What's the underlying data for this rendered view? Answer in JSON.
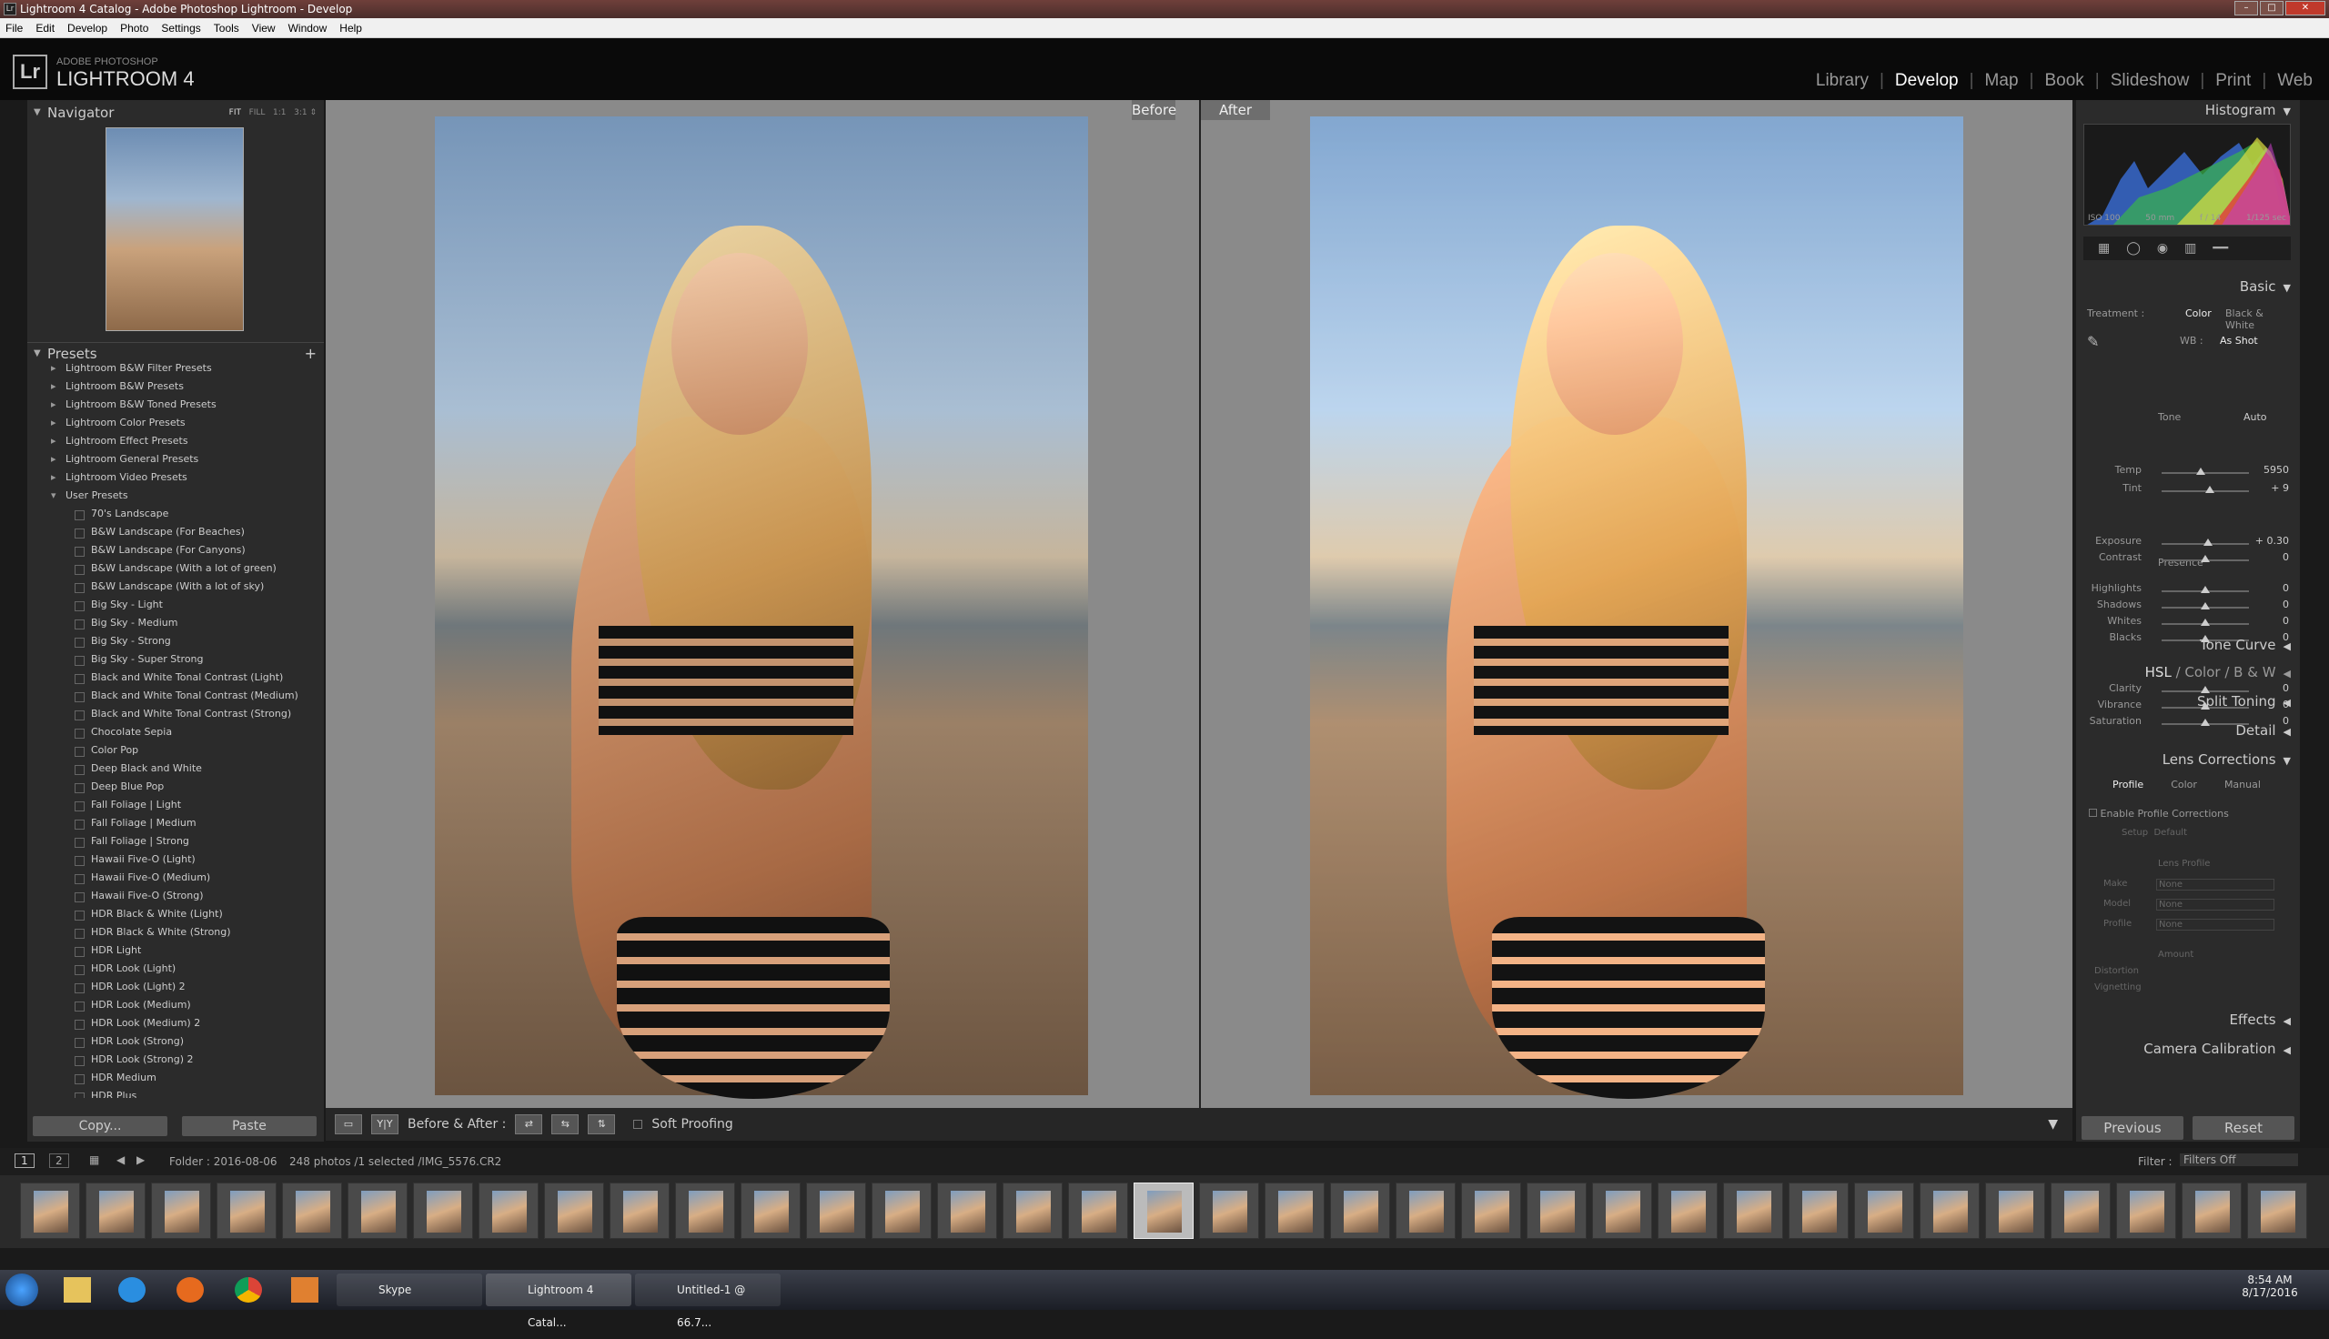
{
  "window": {
    "title": "Lightroom 4 Catalog - Adobe Photoshop Lightroom - Develop"
  },
  "menu": [
    "File",
    "Edit",
    "Develop",
    "Photo",
    "Settings",
    "Tools",
    "View",
    "Window",
    "Help"
  ],
  "identity": {
    "logo": "Lr",
    "line1": "ADOBE PHOTOSHOP",
    "line2": "LIGHTROOM 4"
  },
  "modules": [
    "Library",
    "Develop",
    "Map",
    "Book",
    "Slideshow",
    "Print",
    "Web"
  ],
  "active_module": "Develop",
  "navigator": {
    "title": "Navigator",
    "zoom": [
      "FIT",
      "FILL",
      "1:1",
      "3:1"
    ]
  },
  "presets": {
    "title": "Presets",
    "folders": [
      "Lightroom B&W Filter Presets",
      "Lightroom B&W Presets",
      "Lightroom B&W Toned Presets",
      "Lightroom Color Presets",
      "Lightroom Effect Presets",
      "Lightroom General Presets",
      "Lightroom Video Presets"
    ],
    "user_folder": "User Presets",
    "user": [
      "70's Landscape",
      "B&W Landscape (For Beaches)",
      "B&W Landscape (For Canyons)",
      "B&W Landscape (With a lot of green)",
      "B&W Landscape (With a lot of sky)",
      "Big Sky - Light",
      "Big Sky - Medium",
      "Big Sky - Strong",
      "Big Sky - Super Strong",
      "Black and White Tonal Contrast (Light)",
      "Black and White Tonal Contrast (Medium)",
      "Black and White Tonal Contrast (Strong)",
      "Chocolate Sepia",
      "Color Pop",
      "Deep Black and White",
      "Deep Blue Pop",
      "Fall Foliage | Light",
      "Fall Foliage | Medium",
      "Fall Foliage | Strong",
      "Hawaii Five-O (Light)",
      "Hawaii Five-O (Medium)",
      "Hawaii Five-O (Strong)",
      "HDR Black & White (Light)",
      "HDR Black & White (Strong)",
      "HDR Light",
      "HDR Look (Light)",
      "HDR Look (Light) 2",
      "HDR Look (Medium)",
      "HDR Look (Medium) 2",
      "HDR Look (Strong)",
      "HDR Look (Strong) 2",
      "HDR Medium",
      "HDR Plus"
    ]
  },
  "left_buttons": {
    "copy": "Copy...",
    "paste": "Paste"
  },
  "before_label": "Before",
  "after_label": "After",
  "toolbar": {
    "ba_label": "Before & After :",
    "soft_proofing": "Soft Proofing"
  },
  "histogram": {
    "title": "Histogram",
    "iso": "ISO 100",
    "focal": "50 mm",
    "aperture": "f / 14",
    "shutter": "1/125 sec"
  },
  "basic": {
    "title": "Basic",
    "treatment_label": "Treatment :",
    "color": "Color",
    "bw": "Black & White",
    "wb_label": "WB :",
    "wb_value": "As Shot",
    "tone": "Tone",
    "auto": "Auto",
    "presence": "Presence",
    "sliders": [
      {
        "label": "Temp",
        "value": "5950",
        "pos": 0.45
      },
      {
        "label": "Tint",
        "value": "+ 9",
        "pos": 0.55
      },
      {
        "label": "Exposure",
        "value": "+ 0.30",
        "pos": 0.53
      },
      {
        "label": "Contrast",
        "value": "0",
        "pos": 0.5
      },
      {
        "label": "Highlights",
        "value": "0",
        "pos": 0.5
      },
      {
        "label": "Shadows",
        "value": "0",
        "pos": 0.5
      },
      {
        "label": "Whites",
        "value": "0",
        "pos": 0.5
      },
      {
        "label": "Blacks",
        "value": "0",
        "pos": 0.5
      },
      {
        "label": "Clarity",
        "value": "0",
        "pos": 0.5
      },
      {
        "label": "Vibrance",
        "value": "0",
        "pos": 0.5
      },
      {
        "label": "Saturation",
        "value": "0",
        "pos": 0.5
      }
    ]
  },
  "panels": {
    "tone_curve": "Tone Curve",
    "hsl": "HSL",
    "hsl_color": "Color",
    "hsl_bw": "B & W",
    "split": "Split Toning",
    "detail": "Detail",
    "lens": "Lens Corrections",
    "effects": "Effects",
    "calibration": "Camera Calibration"
  },
  "lens": {
    "tabs": [
      "Profile",
      "Color",
      "Manual"
    ],
    "enable": "Enable Profile Corrections",
    "setup_label": "Setup",
    "setup_value": "Default",
    "lens_profile": "Lens Profile",
    "make": "Make",
    "model": "Model",
    "profile": "Profile",
    "none": "None",
    "amount": "Amount",
    "distortion": "Distortion",
    "vignetting": "Vignetting"
  },
  "right_buttons": {
    "previous": "Previous",
    "reset": "Reset"
  },
  "filmstrip_bar": {
    "folder": "Folder : 2016-08-06",
    "count": "248 photos /1 selected /IMG_5576.CR2",
    "filter_label": "Filter :",
    "filter_value": "Filters Off",
    "pages": [
      "1",
      "2"
    ]
  },
  "taskbar": {
    "items": [
      "Skype",
      "Lightroom 4 Catal...",
      "Untitled-1 @ 66.7..."
    ],
    "time": "8:54 AM",
    "date": "8/17/2016"
  }
}
